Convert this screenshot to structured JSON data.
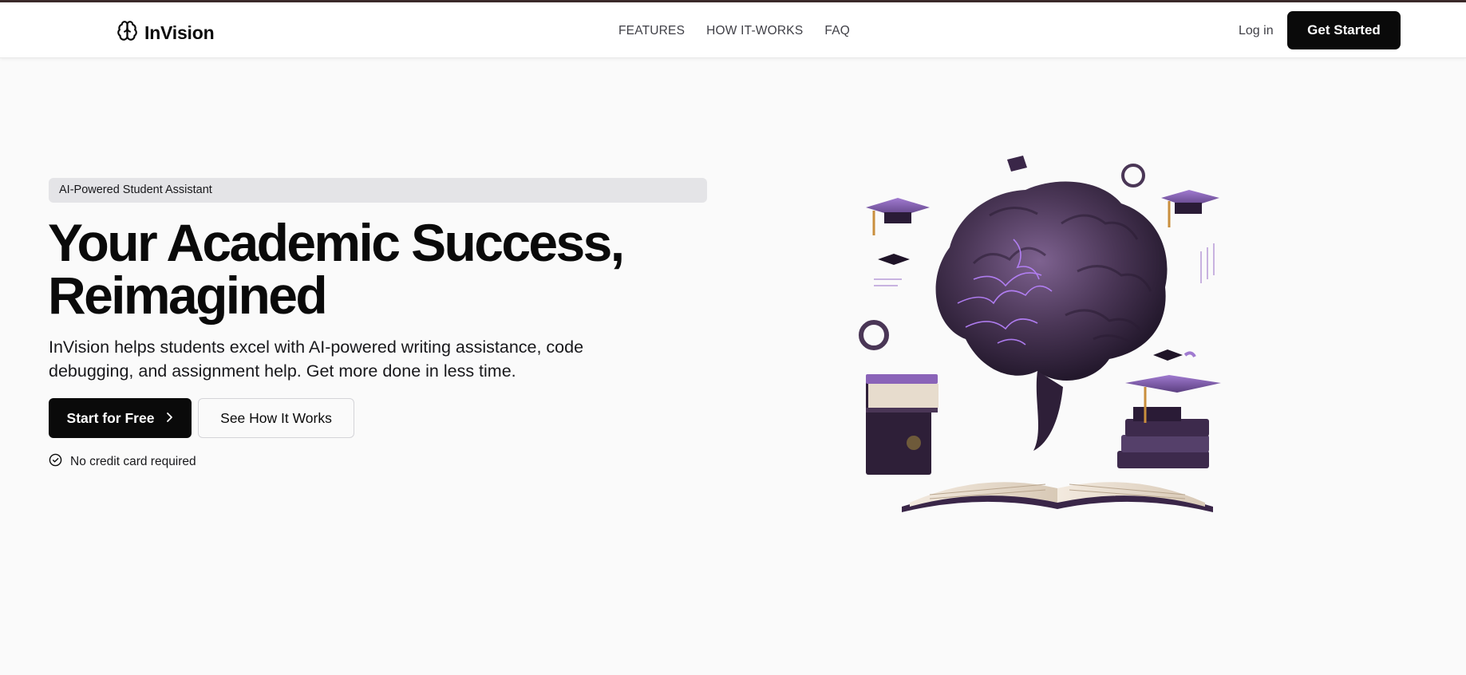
{
  "header": {
    "brand": "InVision",
    "nav": [
      "FEATURES",
      "HOW IT-WORKS",
      "FAQ"
    ],
    "login": "Log in",
    "cta": "Get Started"
  },
  "hero": {
    "badge": "AI-Powered Student Assistant",
    "title_line1": "Your Academic Success,",
    "title_line2": "Reimagined",
    "description": "InVision helps students excel with AI-powered writing assistance, code debugging, and assignment help. Get more done in less time.",
    "primary_button": "Start for Free",
    "secondary_button": "See How It Works",
    "note": "No credit card required"
  },
  "icons": {
    "brand": "brain-icon",
    "primary_button": "chevron-right-icon",
    "note": "check-circle-icon"
  },
  "colors": {
    "brand_dark": "#0a0a0a",
    "badge_bg": "#e4e4e7",
    "illustration_purple": "#8b5cf6"
  }
}
